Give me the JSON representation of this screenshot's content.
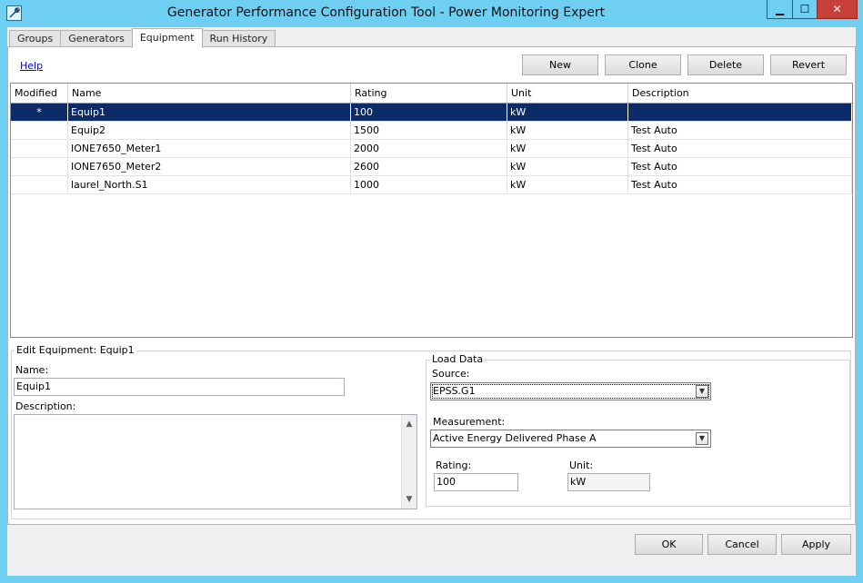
{
  "window": {
    "title": "Generator Performance Configuration Tool - Power Monitoring Expert",
    "minimize_glyph": "▁",
    "maximize_glyph": "☐",
    "close_glyph": "✕"
  },
  "tabs": [
    {
      "label": "Groups"
    },
    {
      "label": "Generators"
    },
    {
      "label": "Equipment"
    },
    {
      "label": "Run History"
    }
  ],
  "toolbar": {
    "help": "Help",
    "new": "New",
    "clone": "Clone",
    "delete": "Delete",
    "revert": "Revert"
  },
  "grid": {
    "columns": [
      "Modified",
      "Name",
      "Rating",
      "Unit",
      "Description"
    ],
    "rows": [
      {
        "modified": "*",
        "name": "Equip1",
        "rating": "100",
        "unit": "kW",
        "description": ""
      },
      {
        "modified": "",
        "name": "Equip2",
        "rating": "1500",
        "unit": "kW",
        "description": "Test Auto"
      },
      {
        "modified": "",
        "name": "IONE7650_Meter1",
        "rating": "2000",
        "unit": "kW",
        "description": "Test Auto"
      },
      {
        "modified": "",
        "name": "IONE7650_Meter2",
        "rating": "2600",
        "unit": "kW",
        "description": "Test Auto"
      },
      {
        "modified": "",
        "name": "laurel_North.S1",
        "rating": "1000",
        "unit": "kW",
        "description": "Test Auto"
      }
    ]
  },
  "edit": {
    "legend": "Edit Equipment: Equip1",
    "name_label": "Name:",
    "name_value": "Equip1",
    "description_label": "Description:",
    "description_value": ""
  },
  "load_data": {
    "legend": "Load Data",
    "source_label": "Source:",
    "source_value": "EPSS.G1",
    "measurement_label": "Measurement:",
    "measurement_value": "Active Energy Delivered Phase A",
    "rating_label": "Rating:",
    "rating_value": "100",
    "unit_label": "Unit:",
    "unit_value": "kW"
  },
  "footer": {
    "ok": "OK",
    "cancel": "Cancel",
    "apply": "Apply"
  },
  "colors": {
    "titlebar": "#6fcff2",
    "selection": "#0d2b66",
    "close_button": "#c7413a"
  }
}
